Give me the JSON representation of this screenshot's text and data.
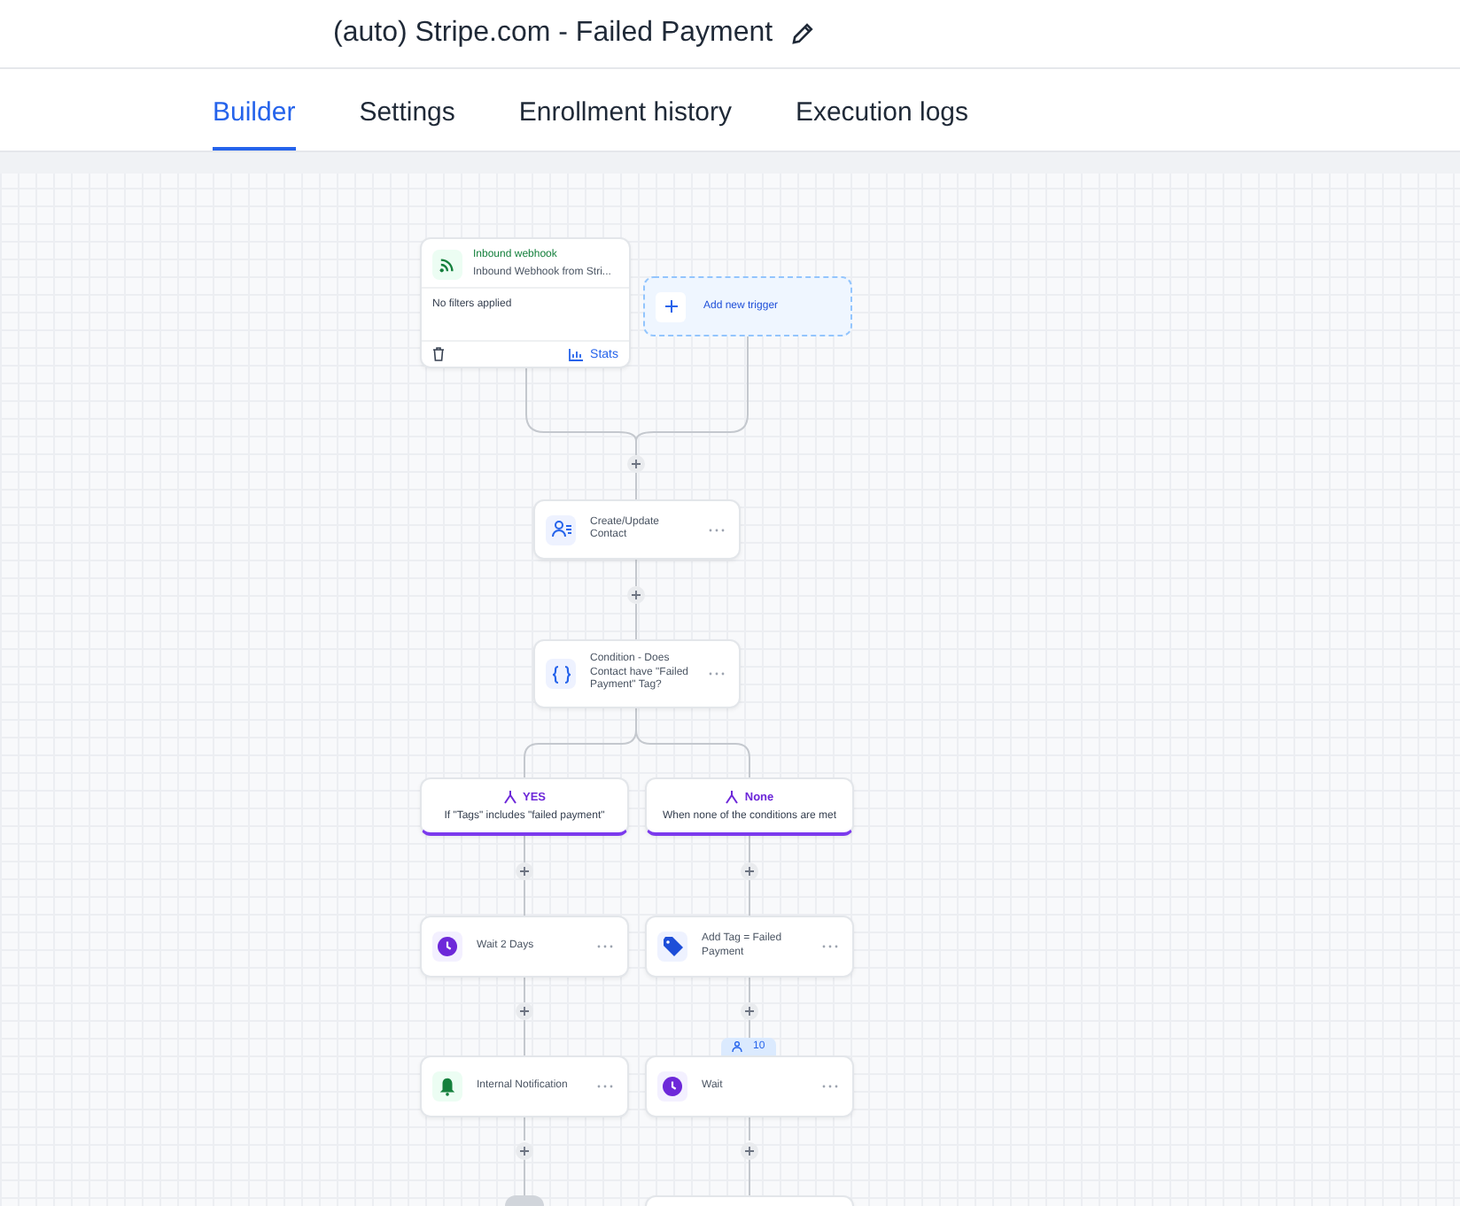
{
  "header": {
    "title": "(auto) Stripe.com - Failed Payment"
  },
  "tabs": [
    {
      "label": "Builder",
      "selected": true
    },
    {
      "label": "Settings",
      "selected": false
    },
    {
      "label": "Enrollment history",
      "selected": false
    },
    {
      "label": "Execution logs",
      "selected": false
    }
  ],
  "trigger": {
    "title": "Inbound webhook",
    "subtitle": "Inbound Webhook from Stri...",
    "filters": "No filters applied",
    "stats": "Stats"
  },
  "add_trigger": {
    "label": "Add new trigger"
  },
  "steps": [
    {
      "kind": "contact",
      "label": "Create/Update Contact"
    },
    {
      "kind": "condition",
      "label": "Condition - Does Contact have \"Failed Payment\" Tag?"
    }
  ],
  "branches": [
    {
      "name": "YES",
      "rule": "If \"Tags\" includes \"failed payment\"",
      "steps": [
        {
          "kind": "wait",
          "label": "Wait 2 Days"
        },
        {
          "kind": "notification",
          "label": "Internal Notification"
        }
      ]
    },
    {
      "name": "None",
      "rule": "When none of the conditions are met",
      "steps": [
        {
          "kind": "tag",
          "label": "Add Tag = Failed Payment"
        },
        {
          "kind": "wait",
          "label": "Wait",
          "badge": "10"
        }
      ]
    }
  ]
}
